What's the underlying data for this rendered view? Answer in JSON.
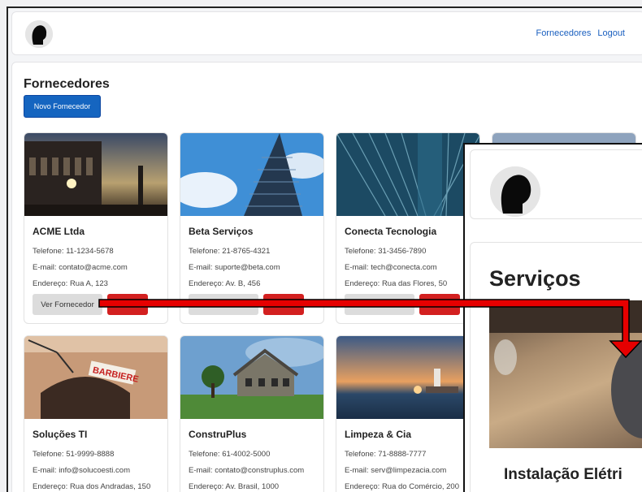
{
  "navbar": {
    "links": [
      "Fornecedores",
      "Logout"
    ]
  },
  "page": {
    "title": "Fornecedores",
    "new_button": "Novo Fornecedor"
  },
  "cards": [
    {
      "name": "ACME Ltda",
      "phone": "Telefone: 11-1234-5678",
      "email": "E-mail: contato@acme.com",
      "address": "Endereço: Rua A, 123",
      "ver_label": "Ver Fornecedor"
    },
    {
      "name": "Beta Serviços",
      "phone": "Telefone: 21-8765-4321",
      "email": "E-mail: suporte@beta.com",
      "address": "Endereço: Av. B, 456",
      "ver_label": ""
    },
    {
      "name": "Conecta Tecnologia",
      "phone": "Telefone: 31-3456-7890",
      "email": "E-mail: tech@conecta.com",
      "address": "Endereço: Rua das Flores, 50",
      "ver_label": ""
    },
    {
      "name": "Soluções TI",
      "phone": "Telefone: 51-9999-8888",
      "email": "E-mail: info@solucoesti.com",
      "address": "Endereço: Rua dos Andradas, 150"
    },
    {
      "name": "ConstruPlus",
      "phone": "Telefone: 61-4002-5000",
      "email": "E-mail: contato@construplus.com",
      "address": "Endereço: Av. Brasil, 1000"
    },
    {
      "name": "Limpeza & Cia",
      "phone": "Telefone: 71-8888-7777",
      "email": "E-mail: serv@limpezacia.com",
      "address": "Endereço: Rua do Comércio, 200"
    }
  ],
  "image_signs": {
    "barbiere": "BARBIERE"
  },
  "overlay": {
    "title": "Serviços",
    "subtitle": "Instalação Elétri"
  },
  "colors": {
    "primary": "#1565c0",
    "danger": "#d32020",
    "link": "#1a5fbf",
    "arrow": "#e60000"
  }
}
